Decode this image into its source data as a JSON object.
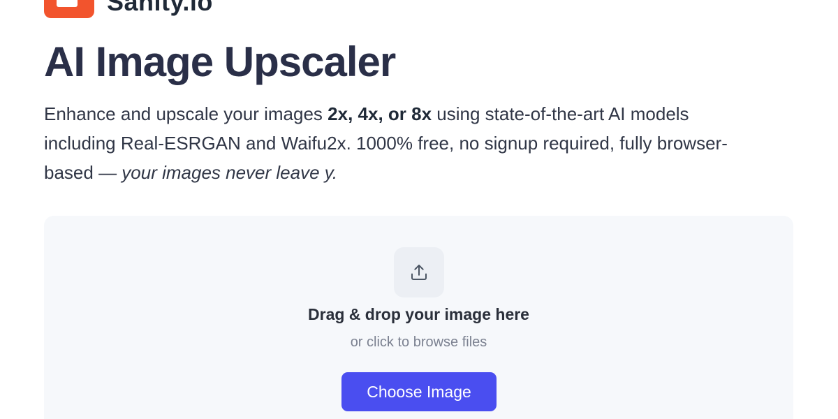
{
  "brand": {
    "name": "Sanity.io",
    "logo_color": "#f2542d"
  },
  "hero": {
    "title": "AI Image Upscaler",
    "desc_part1": "Enhance and upscale your images ",
    "desc_bold": "2x, 4x, or 8x",
    "desc_part2": " using  state-of-the-art AI models including Real-ESRGAN and Waifu2x. 1000% free, no signup required, fully browser-based — ",
    "desc_italic": "your images never leave y."
  },
  "dropzone": {
    "icon": "upload-icon",
    "title": "Drag & drop your image here",
    "subtitle": "or click to browse files",
    "button_label": "Choose Image",
    "button_color": "#4a4ef0"
  }
}
